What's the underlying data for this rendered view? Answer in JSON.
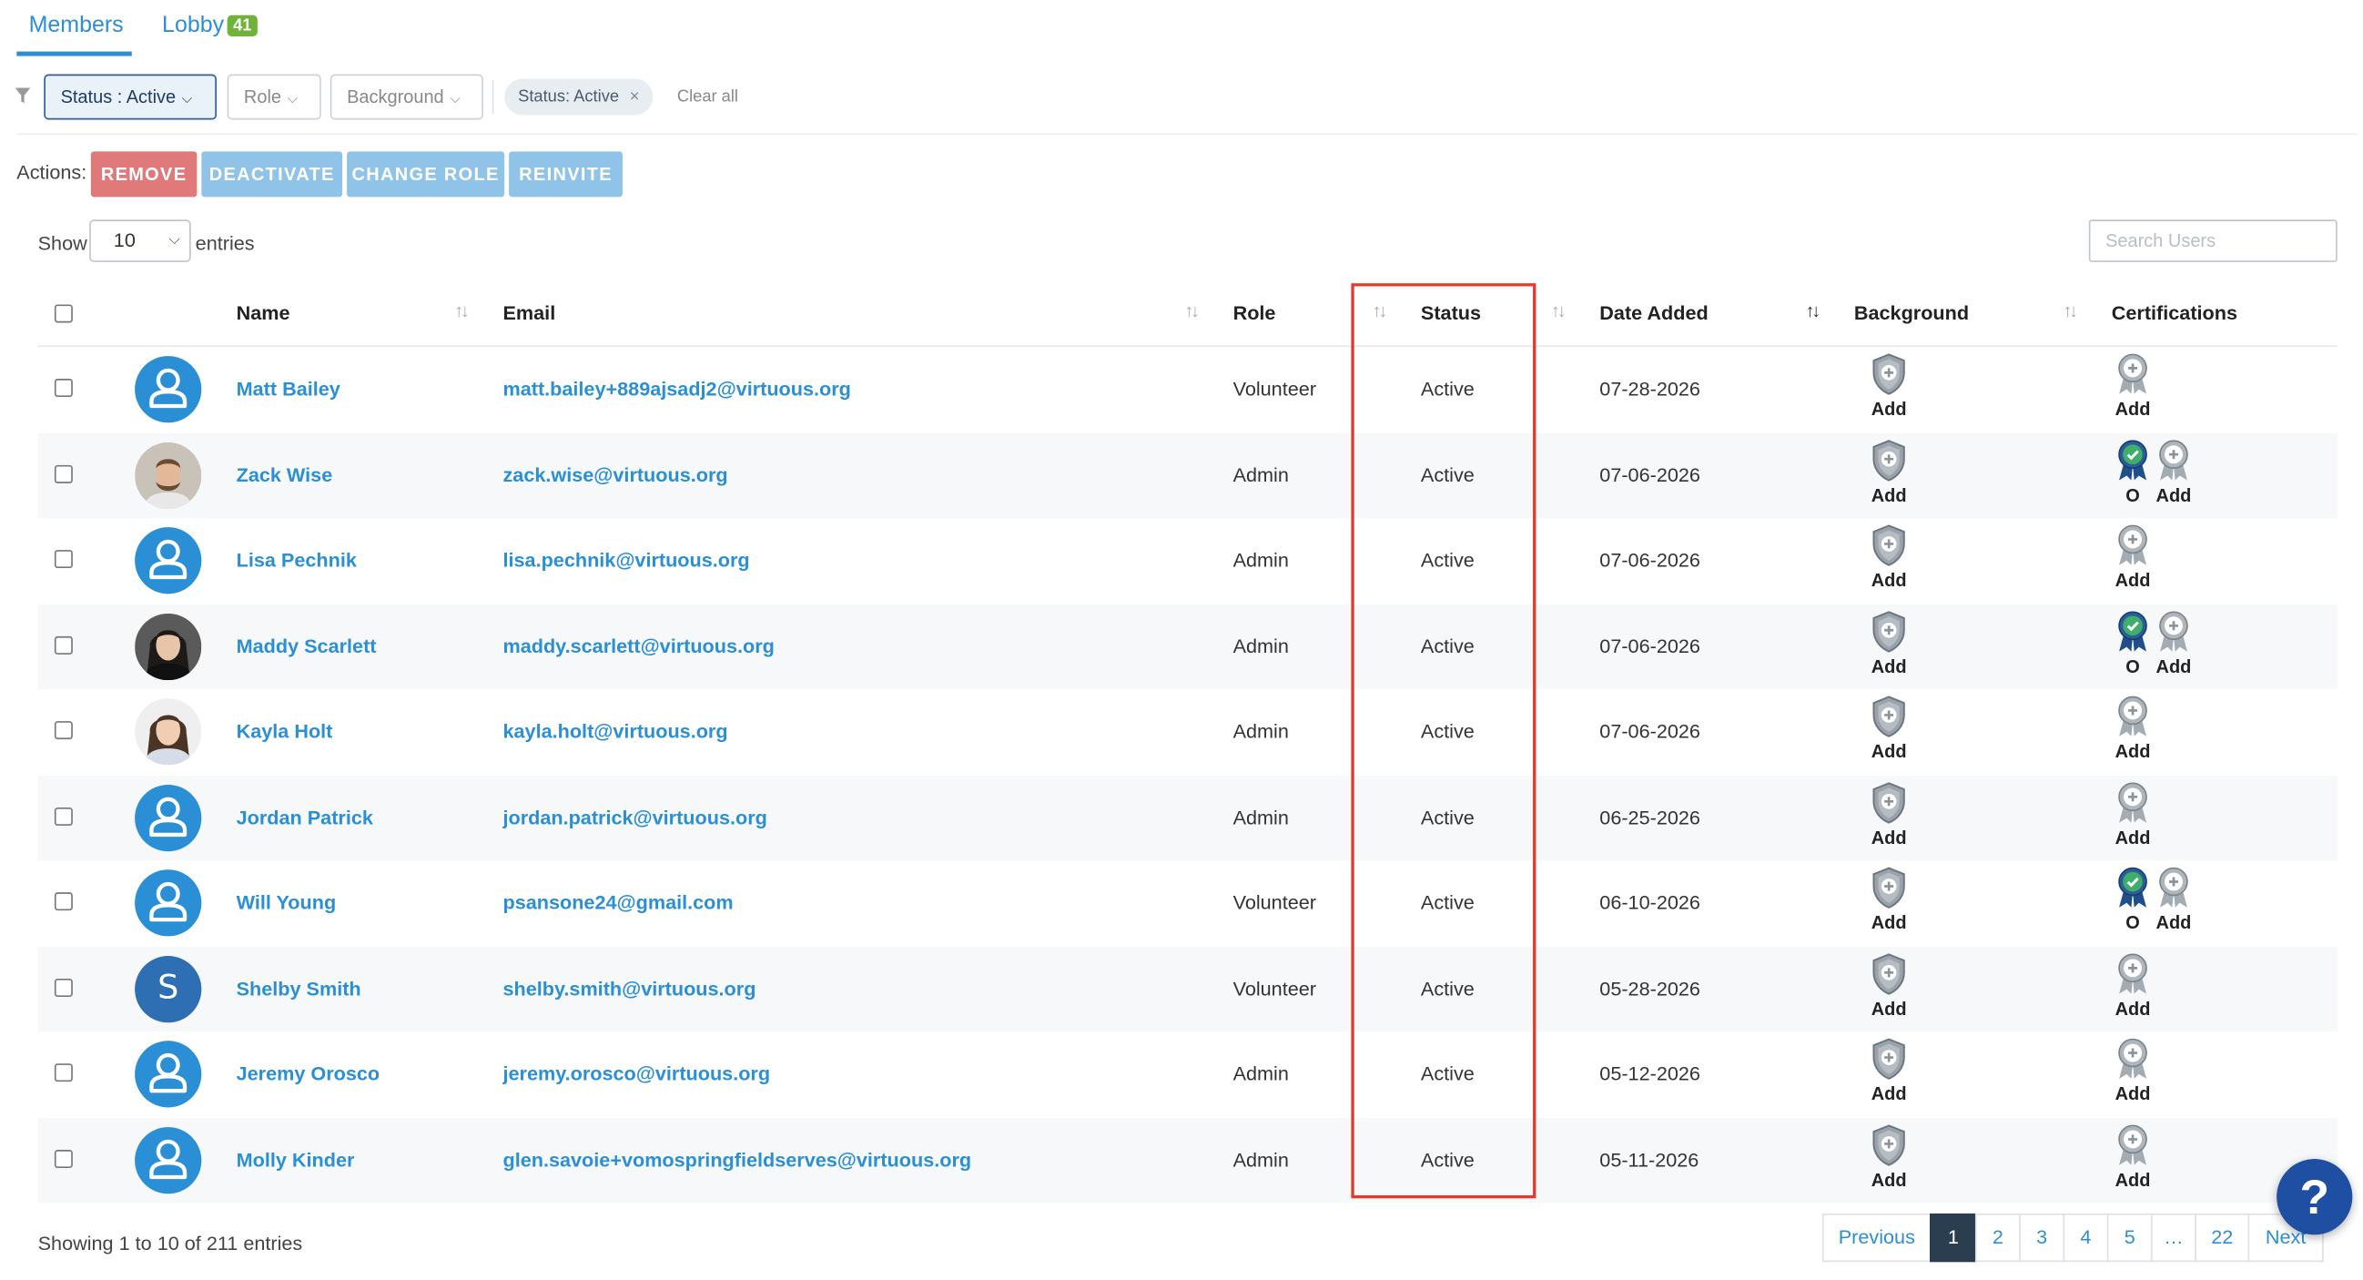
{
  "tabs": {
    "members": "Members",
    "lobby": "Lobby",
    "lobby_count": "41"
  },
  "filters": {
    "status": "Status : Active",
    "role": "Role",
    "background": "Background",
    "chip": "Status: Active",
    "chip_remove": "×",
    "clear_all": "Clear all"
  },
  "actions": {
    "label": "Actions:",
    "remove": "REMOVE",
    "deactivate": "DEACTIVATE",
    "change_role": "CHANGE ROLE",
    "reinvite": "REINVITE"
  },
  "length": {
    "show": "Show",
    "value": "10",
    "entries": "entries"
  },
  "search": {
    "placeholder": "Search Users"
  },
  "columns": {
    "name": "Name",
    "email": "Email",
    "role": "Role",
    "status": "Status",
    "date_added": "Date Added",
    "background": "Background",
    "certifications": "Certifications"
  },
  "rows": [
    {
      "avatar": "person-icon",
      "name": "Matt Bailey",
      "email": "matt.bailey+889ajsadj2@virtuous.org",
      "role": "Volunteer",
      "status": "Active",
      "date": "07-28-2026",
      "bg": "Add",
      "cert_done": "",
      "cert_add": "Add"
    },
    {
      "avatar": "photo-man-beard",
      "name": "Zack Wise",
      "email": "zack.wise@virtuous.org",
      "role": "Admin",
      "status": "Active",
      "date": "07-06-2026",
      "bg": "Add",
      "cert_done": "O",
      "cert_add": "Add"
    },
    {
      "avatar": "person-icon",
      "name": "Lisa Pechnik",
      "email": "lisa.pechnik@virtuous.org",
      "role": "Admin",
      "status": "Active",
      "date": "07-06-2026",
      "bg": "Add",
      "cert_done": "",
      "cert_add": "Add"
    },
    {
      "avatar": "photo-woman-dark-hair",
      "name": "Maddy Scarlett",
      "email": "maddy.scarlett@virtuous.org",
      "role": "Admin",
      "status": "Active",
      "date": "07-06-2026",
      "bg": "Add",
      "cert_done": "O",
      "cert_add": "Add"
    },
    {
      "avatar": "photo-woman-smiling",
      "name": "Kayla Holt",
      "email": "kayla.holt@virtuous.org",
      "role": "Admin",
      "status": "Active",
      "date": "07-06-2026",
      "bg": "Add",
      "cert_done": "",
      "cert_add": "Add"
    },
    {
      "avatar": "person-icon",
      "name": "Jordan Patrick",
      "email": "jordan.patrick@virtuous.org",
      "role": "Admin",
      "status": "Active",
      "date": "06-25-2026",
      "bg": "Add",
      "cert_done": "",
      "cert_add": "Add"
    },
    {
      "avatar": "person-icon",
      "name": "Will Young",
      "email": "psansone24@gmail.com",
      "role": "Volunteer",
      "status": "Active",
      "date": "06-10-2026",
      "bg": "Add",
      "cert_done": "O",
      "cert_add": "Add"
    },
    {
      "avatar": "letter",
      "avatar_letter": "S",
      "name": "Shelby Smith",
      "email": "shelby.smith@virtuous.org",
      "role": "Volunteer",
      "status": "Active",
      "date": "05-28-2026",
      "bg": "Add",
      "cert_done": "",
      "cert_add": "Add"
    },
    {
      "avatar": "person-icon",
      "name": "Jeremy Orosco",
      "email": "jeremy.orosco@virtuous.org",
      "role": "Admin",
      "status": "Active",
      "date": "05-12-2026",
      "bg": "Add",
      "cert_done": "",
      "cert_add": "Add"
    },
    {
      "avatar": "person-icon",
      "name": "Molly Kinder",
      "email": "glen.savoie+vomospringfieldserves@virtuous.org",
      "role": "Admin",
      "status": "Active",
      "date": "05-11-2026",
      "bg": "Add",
      "cert_done": "",
      "cert_add": "Add"
    }
  ],
  "footer": {
    "showing": "Showing 1 to 10 of 211 entries"
  },
  "pagination": {
    "previous": "Previous",
    "pages": [
      "1",
      "2",
      "3",
      "4",
      "5",
      "…",
      "22"
    ],
    "next": "Next",
    "current": "1"
  },
  "help": "?",
  "colors": {
    "accent": "#2a8fd4",
    "remove": "#e07a7a",
    "action": "#8fc4e8",
    "highlight": "#e13b2d",
    "badge": "#6fb33b"
  }
}
